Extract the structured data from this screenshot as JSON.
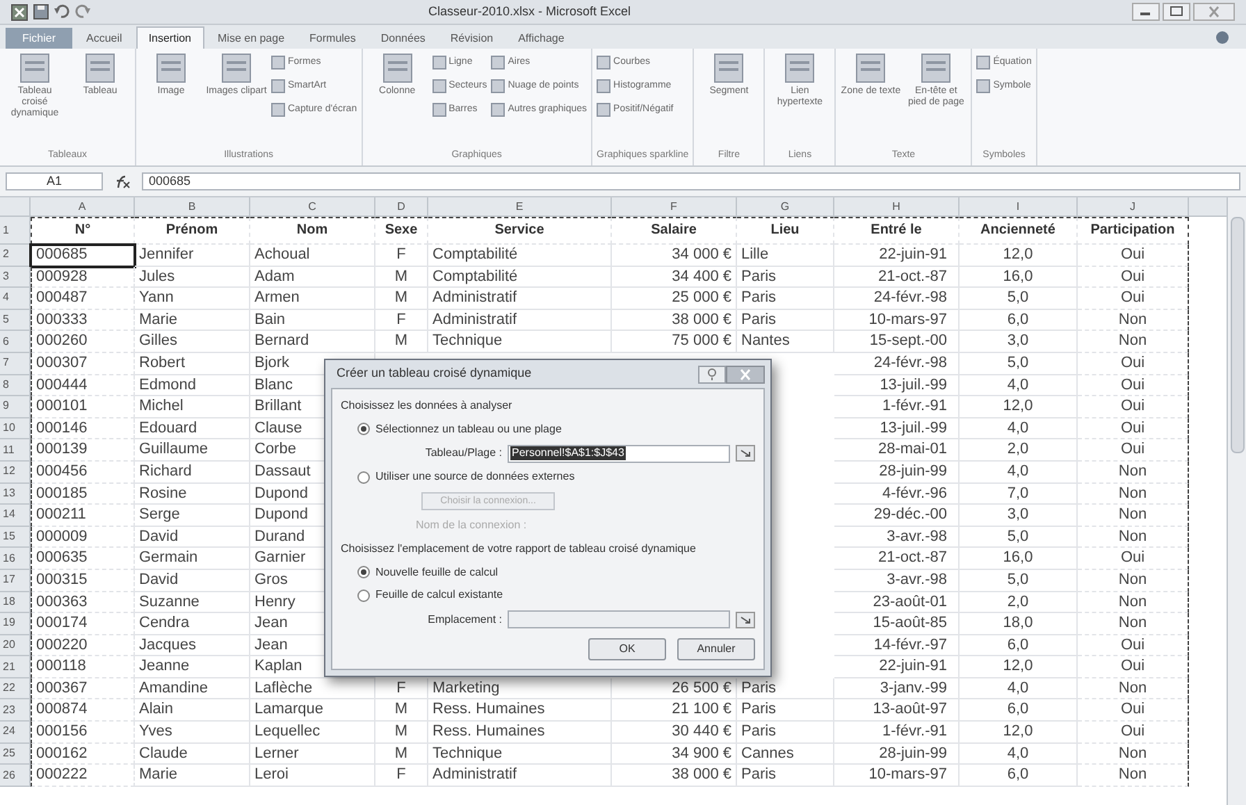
{
  "window": {
    "title": "Classeur-2010.xlsx - Microsoft Excel"
  },
  "ribbon_tabs": [
    {
      "label": "Fichier",
      "selected": false,
      "kind": "file"
    },
    {
      "label": "Accueil",
      "selected": false,
      "kind": "tab"
    },
    {
      "label": "Insertion",
      "selected": true,
      "kind": "tab"
    },
    {
      "label": "Mise en page",
      "selected": false,
      "kind": "tab"
    },
    {
      "label": "Formules",
      "selected": false,
      "kind": "tab"
    },
    {
      "label": "Données",
      "selected": false,
      "kind": "tab"
    },
    {
      "label": "Révision",
      "selected": false,
      "kind": "tab"
    },
    {
      "label": "Affichage",
      "selected": false,
      "kind": "tab"
    }
  ],
  "ribbon_groups": [
    {
      "label": "Tableaux",
      "items": [
        {
          "kind": "large",
          "label": "Tableau croisé dynamique"
        },
        {
          "kind": "large",
          "label": "Tableau"
        }
      ]
    },
    {
      "label": "Illustrations",
      "items": [
        {
          "kind": "large",
          "label": "Image"
        },
        {
          "kind": "large",
          "label": "Images clipart"
        },
        {
          "kind": "stack",
          "labels": [
            "Formes",
            "SmartArt",
            "Capture d'écran"
          ]
        }
      ]
    },
    {
      "label": "Graphiques",
      "items": [
        {
          "kind": "large",
          "label": "Colonne"
        },
        {
          "kind": "stack",
          "labels": [
            "Ligne",
            "Secteurs",
            "Barres"
          ]
        },
        {
          "kind": "stack",
          "labels": [
            "Aires",
            "Nuage de points",
            "Autres graphiques"
          ]
        }
      ]
    },
    {
      "label": "Graphiques sparkline",
      "items": [
        {
          "kind": "stack",
          "labels": [
            "Courbes",
            "Histogramme",
            "Positif/Négatif"
          ]
        }
      ]
    },
    {
      "label": "Filtre",
      "items": [
        {
          "kind": "large",
          "label": "Segment"
        }
      ]
    },
    {
      "label": "Liens",
      "items": [
        {
          "kind": "large",
          "label": "Lien hypertexte"
        }
      ]
    },
    {
      "label": "Texte",
      "items": [
        {
          "kind": "large",
          "label": "Zone de texte"
        },
        {
          "kind": "large",
          "label": "En-tête et pied de page"
        }
      ]
    },
    {
      "label": "Symboles",
      "items": [
        {
          "kind": "stack",
          "labels": [
            "Équation",
            "Symbole"
          ]
        }
      ]
    }
  ],
  "formula_bar": {
    "cell": "A1",
    "value": "000685"
  },
  "sheet": {
    "columns": [
      "A",
      "B",
      "C",
      "D",
      "E",
      "F",
      "G",
      "H",
      "I",
      "J"
    ],
    "header": {
      "number": "1",
      "cells": [
        "N°",
        "Prénom",
        "Nom",
        "Sexe",
        "Service",
        "Salaire",
        "Lieu",
        "Entré le",
        "Ancienneté",
        "Participation"
      ]
    },
    "rows": [
      {
        "number": "2",
        "active": true,
        "cells": [
          "000685",
          "Jennifer",
          "Achoual",
          "F",
          "Comptabilité",
          "34 000 €",
          "Lille",
          "22-juin-91",
          "12,0",
          "Oui"
        ]
      },
      {
        "number": "3",
        "active": false,
        "cells": [
          "000928",
          "Jules",
          "Adam",
          "M",
          "Comptabilité",
          "34 400 €",
          "Paris",
          "21-oct.-87",
          "16,0",
          "Oui"
        ]
      },
      {
        "number": "4",
        "active": false,
        "cells": [
          "000487",
          "Yann",
          "Armen",
          "M",
          "Administratif",
          "25 000 €",
          "Paris",
          "24-févr.-98",
          "5,0",
          "Oui"
        ]
      },
      {
        "number": "5",
        "active": false,
        "cells": [
          "000333",
          "Marie",
          "Bain",
          "F",
          "Administratif",
          "38 000 €",
          "Paris",
          "10-mars-97",
          "6,0",
          "Non"
        ]
      },
      {
        "number": "6",
        "active": false,
        "cells": [
          "000260",
          "Gilles",
          "Bernard",
          "M",
          "Technique",
          "75 000 €",
          "Nantes",
          "15-sept.-00",
          "3,0",
          "Non"
        ]
      },
      {
        "number": "7",
        "active": false,
        "cells": [
          "000307",
          "Robert",
          "Bjork",
          null,
          null,
          null,
          null,
          "24-févr.-98",
          "5,0",
          "Oui"
        ]
      },
      {
        "number": "8",
        "active": false,
        "cells": [
          "000444",
          "Edmond",
          "Blanc",
          null,
          null,
          null,
          null,
          "13-juil.-99",
          "4,0",
          "Oui"
        ]
      },
      {
        "number": "9",
        "active": false,
        "cells": [
          "000101",
          "Michel",
          "Brillant",
          null,
          null,
          null,
          null,
          "1-févr.-91",
          "12,0",
          "Oui"
        ]
      },
      {
        "number": "10",
        "active": false,
        "cells": [
          "000146",
          "Edouard",
          "Clause",
          null,
          null,
          null,
          null,
          "13-juil.-99",
          "4,0",
          "Oui"
        ]
      },
      {
        "number": "11",
        "active": false,
        "cells": [
          "000139",
          "Guillaume",
          "Corbe",
          null,
          null,
          null,
          null,
          "28-mai-01",
          "2,0",
          "Oui"
        ]
      },
      {
        "number": "12",
        "active": false,
        "cells": [
          "000456",
          "Richard",
          "Dassaut",
          null,
          null,
          null,
          null,
          "28-juin-99",
          "4,0",
          "Non"
        ]
      },
      {
        "number": "13",
        "active": false,
        "cells": [
          "000185",
          "Rosine",
          "Dupond",
          null,
          null,
          null,
          null,
          "4-févr.-96",
          "7,0",
          "Non"
        ]
      },
      {
        "number": "14",
        "active": false,
        "cells": [
          "000211",
          "Serge",
          "Dupond",
          null,
          null,
          null,
          null,
          "29-déc.-00",
          "3,0",
          "Non"
        ]
      },
      {
        "number": "15",
        "active": false,
        "cells": [
          "000009",
          "David",
          "Durand",
          null,
          null,
          null,
          null,
          "3-avr.-98",
          "5,0",
          "Non"
        ]
      },
      {
        "number": "16",
        "active": false,
        "cells": [
          "000635",
          "Germain",
          "Garnier",
          null,
          null,
          null,
          null,
          "21-oct.-87",
          "16,0",
          "Oui"
        ]
      },
      {
        "number": "17",
        "active": false,
        "cells": [
          "000315",
          "David",
          "Gros",
          null,
          null,
          null,
          null,
          "3-avr.-98",
          "5,0",
          "Non"
        ]
      },
      {
        "number": "18",
        "active": false,
        "cells": [
          "000363",
          "Suzanne",
          "Henry",
          null,
          null,
          null,
          null,
          "23-août-01",
          "2,0",
          "Non"
        ]
      },
      {
        "number": "19",
        "active": false,
        "cells": [
          "000174",
          "Cendra",
          "Jean",
          null,
          null,
          null,
          null,
          "15-août-85",
          "18,0",
          "Non"
        ]
      },
      {
        "number": "20",
        "active": false,
        "cells": [
          "000220",
          "Jacques",
          "Jean",
          null,
          null,
          null,
          null,
          "14-févr.-97",
          "6,0",
          "Oui"
        ]
      },
      {
        "number": "21",
        "active": false,
        "cells": [
          "000118",
          "Jeanne",
          "Kaplan",
          null,
          null,
          null,
          null,
          "22-juin-91",
          "12,0",
          "Oui"
        ]
      },
      {
        "number": "22",
        "active": false,
        "cells": [
          "000367",
          "Amandine",
          "Laflèche",
          "F",
          "Marketing",
          "26 500 €",
          "Paris",
          "3-janv.-99",
          "4,0",
          "Non"
        ]
      },
      {
        "number": "23",
        "active": false,
        "cells": [
          "000874",
          "Alain",
          "Lamarque",
          "M",
          "Ress. Humaines",
          "21 100 €",
          "Paris",
          "13-août-97",
          "6,0",
          "Oui"
        ]
      },
      {
        "number": "24",
        "active": false,
        "cells": [
          "000156",
          "Yves",
          "Lequellec",
          "M",
          "Ress. Humaines",
          "30 440 €",
          "Paris",
          "1-févr.-91",
          "12,0",
          "Oui"
        ]
      },
      {
        "number": "25",
        "active": false,
        "cells": [
          "000162",
          "Claude",
          "Lerner",
          "M",
          "Technique",
          "34 900 €",
          "Cannes",
          "28-juin-99",
          "4,0",
          "Non"
        ]
      },
      {
        "number": "26",
        "active": false,
        "cells": [
          "000222",
          "Marie",
          "Leroi",
          "F",
          "Administratif",
          "38 000 €",
          "Paris",
          "10-mars-97",
          "6,0",
          "Non"
        ]
      }
    ]
  },
  "dialog": {
    "title": "Créer un tableau croisé dynamique",
    "sections": [
      {
        "heading": "Choisissez les données à analyser",
        "options": [
          {
            "label": "Sélectionnez un tableau ou une plage",
            "selected": true,
            "field": {
              "label": "Tableau/Plage :",
              "value": "Personnel!$A$1:$J$43"
            }
          },
          {
            "label": "Utiliser une source de données externes",
            "selected": false,
            "button": {
              "label": "Choisir la connexion...",
              "disabled": true
            },
            "note": {
              "label": "Nom de la connexion :",
              "disabled": true
            }
          }
        ]
      },
      {
        "heading": "Choisissez l'emplacement de votre rapport de tableau croisé dynamique",
        "options": [
          {
            "label": "Nouvelle feuille de calcul",
            "selected": true
          },
          {
            "label": "Feuille de calcul existante",
            "selected": false,
            "field": {
              "label": "Emplacement :"
            }
          }
        ]
      }
    ],
    "buttons": [
      "OK",
      "Annuler"
    ]
  }
}
